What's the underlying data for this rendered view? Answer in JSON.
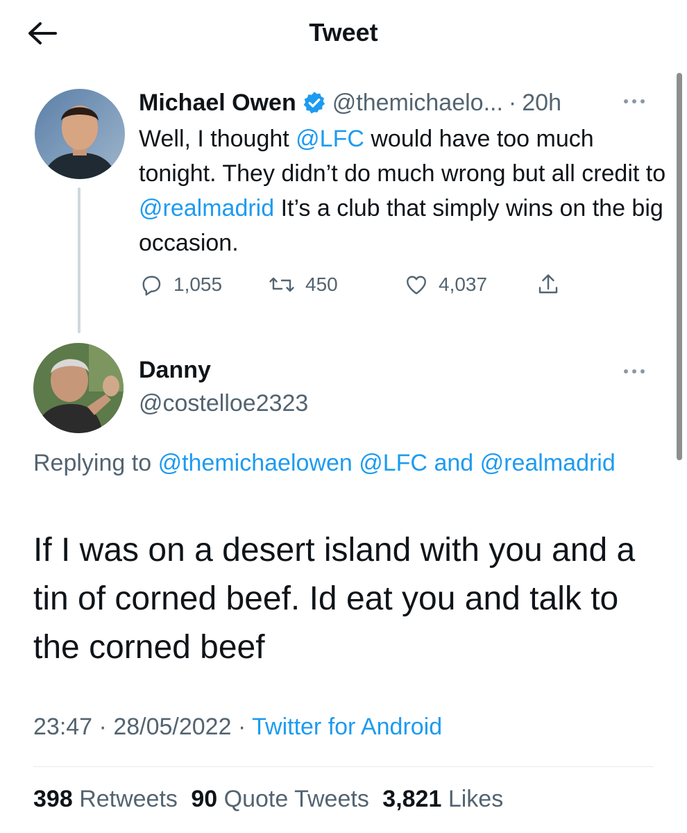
{
  "header": {
    "title": "Tweet"
  },
  "parent_tweet": {
    "author_name": "Michael Owen",
    "author_handle": "@themichaelo...",
    "separator": "·",
    "time": "20h",
    "text_parts": {
      "t1": "Well, I thought ",
      "m1": "@LFC",
      "t2": " would have too much tonight. They didn’t do much wrong but all credit to ",
      "m2": "@realmadrid",
      "t3": " It’s a club that simply wins on the big occasion."
    },
    "replies": "1,055",
    "retweets": "450",
    "likes": "4,037"
  },
  "reply_tweet": {
    "author_name": "Danny",
    "author_handle": "@costelloe2323",
    "replying_label": "Replying to",
    "replying_to": [
      "@themichaelowen",
      "@LFC",
      "@realmadrid"
    ],
    "replying_and": "and",
    "text": "If I was on a desert island with you and a tin of corned beef. Id eat you and talk to the corned beef",
    "time": "23:47",
    "date": "28/05/2022",
    "separator": "·",
    "source": "Twitter for Android",
    "stats": {
      "retweets_count": "398",
      "retweets_label": "Retweets",
      "quotes_count": "90",
      "quotes_label": "Quote Tweets",
      "likes_count": "3,821",
      "likes_label": "Likes"
    }
  },
  "icons": {
    "back": "arrow-left-icon",
    "verified": "verified-badge-icon",
    "more": "more-icon",
    "reply": "reply-icon",
    "retweet": "retweet-icon",
    "like": "heart-icon",
    "share": "share-icon"
  },
  "colors": {
    "accent": "#1d9bf0",
    "text": "#0f1419",
    "muted": "#536471"
  }
}
